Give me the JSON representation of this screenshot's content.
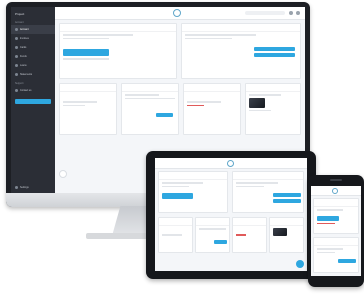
{
  "desktop": {
    "sidebar": {
      "brand": "Project",
      "sections": [
        {
          "label": "Account",
          "items": [
            "Account",
            "Invoices",
            "Cards",
            "Funds",
            "Loans",
            "Statements"
          ]
        },
        {
          "label": "Support",
          "items": [
            "Contact us"
          ]
        }
      ],
      "cta_label": "",
      "footer_label": "Settings"
    }
  },
  "colors": {
    "accent": "#2ea7e0",
    "sidebar": "#2b2e36",
    "negative": "#e05a5a",
    "device_frame": "#1d1f24"
  }
}
